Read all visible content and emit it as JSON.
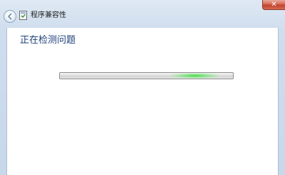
{
  "window": {
    "title": "程序兼容性"
  },
  "titlebar": {
    "back_icon": "back-arrow-icon",
    "app_icon": "compatibility-troubleshooter-icon",
    "close_icon": "close-icon",
    "close_glyph": "✕"
  },
  "main": {
    "heading": "正在检测问题",
    "progress": {
      "style": "marquee",
      "indicator_position": 0.78
    }
  },
  "colors": {
    "heading": "#1e3f7a",
    "progress_glow": "#46dc46",
    "close_button": "#c2432c"
  }
}
